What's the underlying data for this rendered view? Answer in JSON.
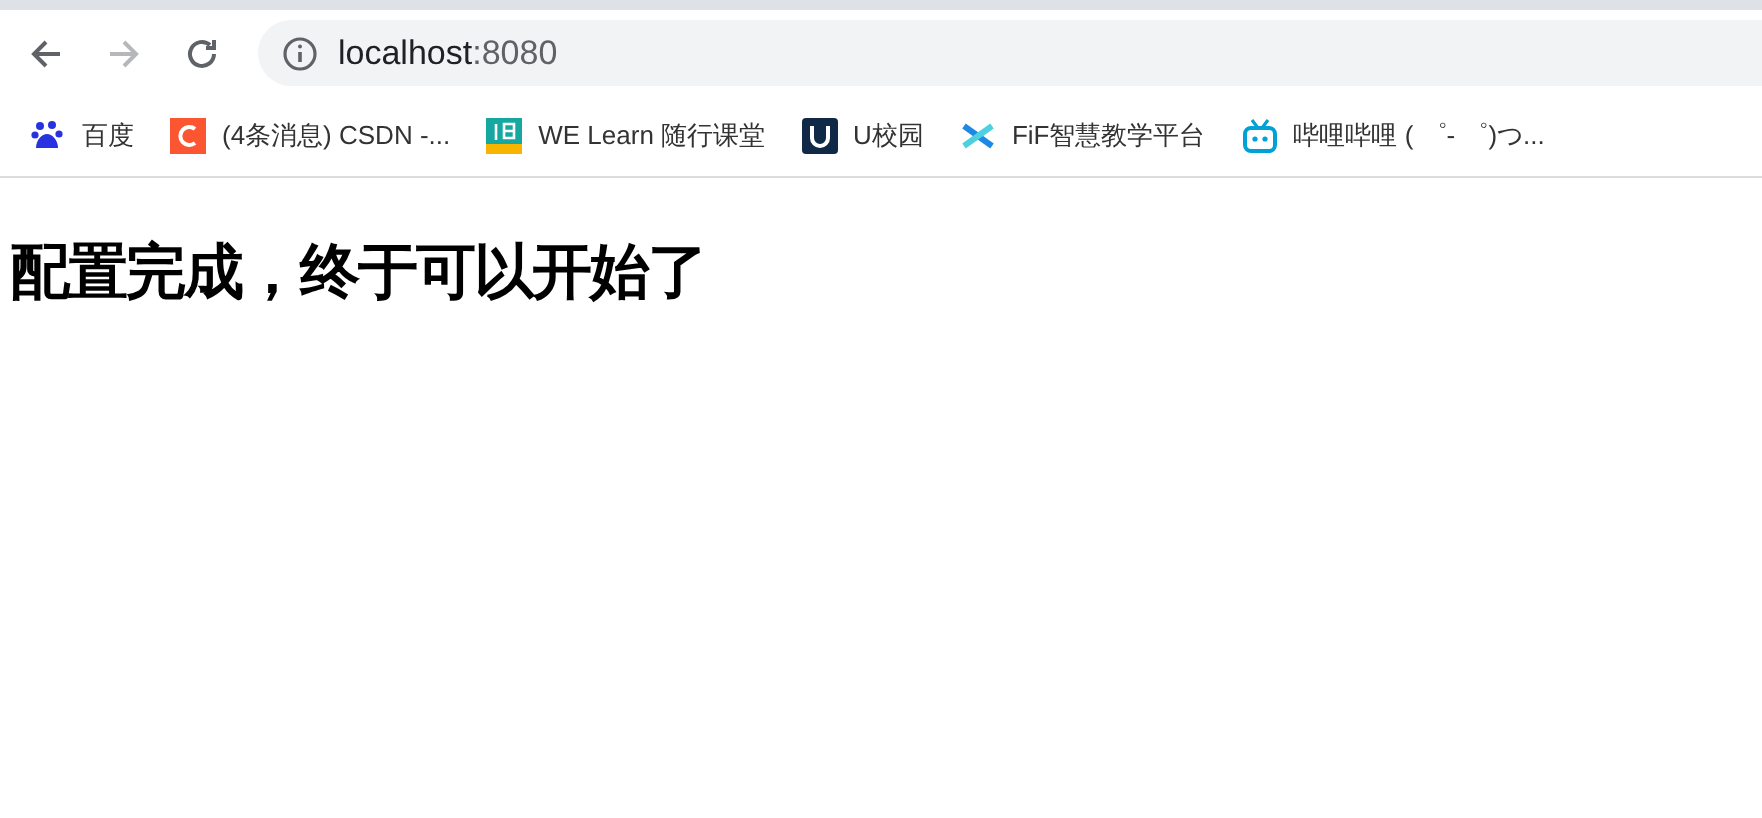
{
  "toolbar": {
    "nav_buttons": [
      {
        "kind": "back",
        "disabled": false
      },
      {
        "kind": "forward",
        "disabled": true
      },
      {
        "kind": "reload",
        "disabled": false
      }
    ],
    "address": {
      "host": "localhost",
      "port": ":8080"
    }
  },
  "bookmarks": [
    {
      "kind": "paw",
      "label": "百度"
    },
    {
      "kind": "letter-c",
      "label": "(4条消息) CSDN -..."
    },
    {
      "kind": "course",
      "label": "WE Learn 随行课堂"
    },
    {
      "kind": "u-square",
      "label": "U校园"
    },
    {
      "kind": "cross",
      "label": "FiF智慧教学平台"
    },
    {
      "kind": "tv",
      "label": "哔哩哔哩 ( ゜- ゜)つ..."
    }
  ],
  "page": {
    "heading": "配置完成，终于可以开始了"
  }
}
